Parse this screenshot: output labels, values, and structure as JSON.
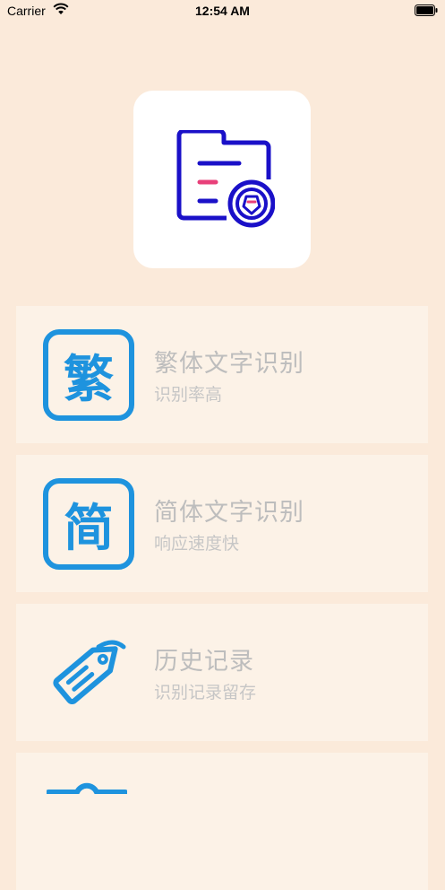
{
  "status_bar": {
    "carrier": "Carrier",
    "time": "12:54 AM"
  },
  "menu": [
    {
      "icon_glyph": "繁",
      "title": "繁体文字识别",
      "subtitle": "识别率高"
    },
    {
      "icon_glyph": "简",
      "title": "简体文字识别",
      "subtitle": "响应速度快"
    },
    {
      "title": "历史记录",
      "subtitle": "识别记录留存"
    }
  ],
  "colors": {
    "background": "#fbeada",
    "card": "#fcf2e7",
    "icon_blue": "#1e93de",
    "logo_navy": "#1a10c8",
    "logo_pink": "#e8407a"
  },
  "icons": {
    "logo": "folder-seal-icon",
    "history": "tag-icon"
  }
}
